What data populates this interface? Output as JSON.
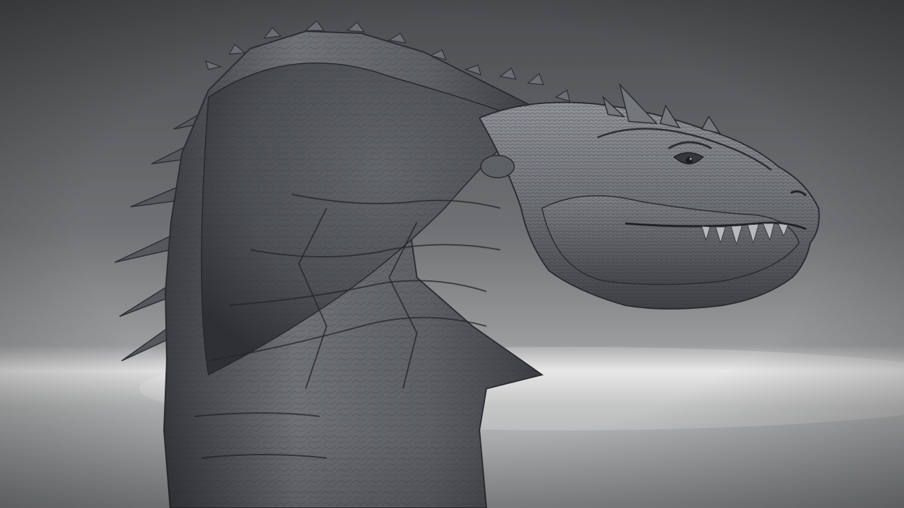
{
  "scene": {
    "subject": "dragon-head-sculpt",
    "backdrop": "studio-gray-gradient"
  },
  "colors": {
    "backdrop_top": "#4b4d50",
    "backdrop_mid": "#8a8c8f",
    "floor_glow": "#dcdcdc",
    "floor": "#9a9b9d",
    "clay_light": "#8e9196",
    "clay_mid": "#6a6d72",
    "clay_dark": "#2f3135",
    "crease": "#25272b"
  }
}
